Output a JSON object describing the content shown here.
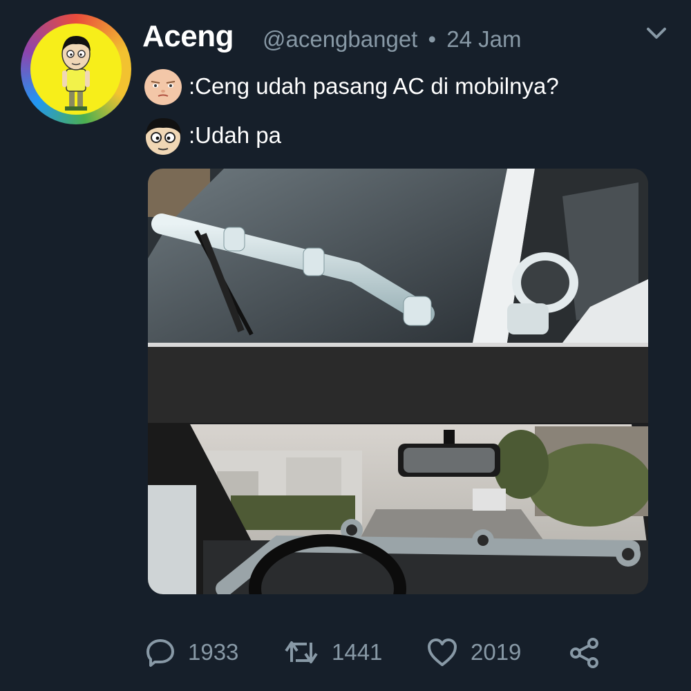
{
  "user": {
    "display_name": "Aceng",
    "handle": "@acengbanget",
    "separator": "•",
    "timestamp": "24 Jam",
    "avatar_icon": "cartoon-boy-avatar"
  },
  "tweet": {
    "lines": [
      {
        "icon": "boss-baby-face-icon",
        "text": ":Ceng udah pasang AC di mobilnya?"
      },
      {
        "icon": "cartoon-boy-face-icon",
        "text": ":Udah pa"
      }
    ]
  },
  "media": {
    "top_image": "car-exterior-with-pvc-pipes-on-windshield",
    "bottom_image": "car-interior-with-pvc-pipe-ac-on-dashboard"
  },
  "actions": {
    "replies": "1933",
    "retweets": "1441",
    "likes": "2019"
  },
  "colors": {
    "background": "#161f2a",
    "muted_text": "#8899a6",
    "text": "#ffffff"
  }
}
